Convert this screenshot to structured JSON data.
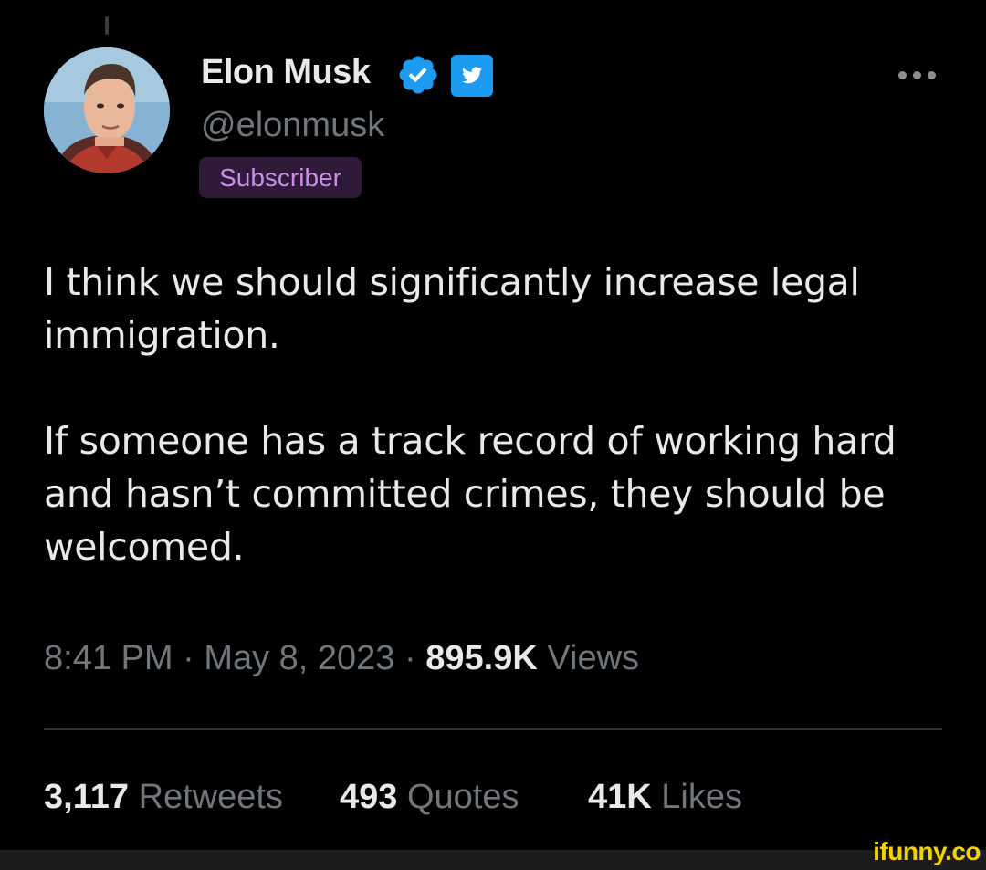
{
  "author": {
    "display_name": "Elon Musk",
    "handle": "@elonmusk",
    "badge_label": "Subscriber",
    "verified_icon": "verified-check-icon",
    "platform_icon": "twitter-bird-icon",
    "avatar": "profile-photo"
  },
  "tweet": {
    "paragraphs": [
      "I think we should significantly increase legal immigration.",
      "If someone has a track record of working hard and hasn’t committed crimes, they should be welcomed."
    ]
  },
  "meta": {
    "time": "8:41 PM",
    "separator": "·",
    "date": "May 8, 2023",
    "views_count": "895.9K",
    "views_label": "Views"
  },
  "stats": {
    "retweets_count": "3,117",
    "retweets_label": "Retweets",
    "quotes_count": "493",
    "quotes_label": "Quotes",
    "likes_count": "41K",
    "likes_label": "Likes"
  },
  "watermark": "ifunny.co",
  "colors": {
    "background": "#000000",
    "primary_text": "#e7e9ea",
    "secondary_text": "#71767b",
    "verified_blue": "#1d9bf0",
    "subscriber_badge_bg": "#2f1a3a",
    "subscriber_badge_text": "#c98ee6",
    "watermark_yellow": "#f2d300"
  }
}
